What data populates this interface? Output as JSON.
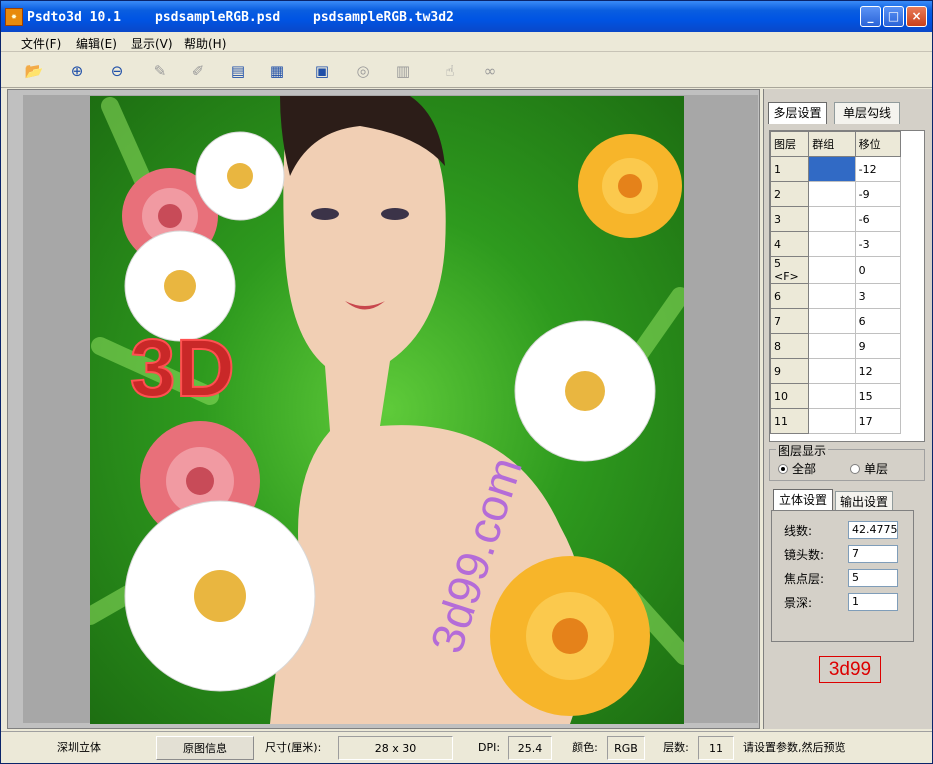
{
  "titlebar": {
    "app": "Psdto3d 10.1",
    "file_psd": "psdsampleRGB.psd",
    "file_tw3d2": "psdsampleRGB.tw3d2",
    "minimize": "_",
    "maximize": "□",
    "close": "×"
  },
  "menu": {
    "file": "文件(F)",
    "edit": "编辑(E)",
    "view": "显示(V)",
    "help": "帮助(H)"
  },
  "toolbar_icons": [
    "open-folder-icon",
    "zoom-in-icon",
    "zoom-out-icon",
    "pen-icon",
    "pen-line-icon",
    "layer-edit-icon",
    "layer-image-icon",
    "monitor-icon",
    "target-icon",
    "save-disk-icon",
    "hand-icon",
    "link-icon"
  ],
  "image": {
    "watermark_3d": "3D",
    "watermark_site": "3d99.com"
  },
  "panel": {
    "tab_multi": "多层设置",
    "tab_single": "单层勾线",
    "grid_headers": [
      "图层",
      "群组",
      "移位"
    ],
    "layers": [
      {
        "layer": "1",
        "group": "",
        "shift": "-12"
      },
      {
        "layer": "2",
        "group": "",
        "shift": "-9"
      },
      {
        "layer": "3",
        "group": "",
        "shift": "-6"
      },
      {
        "layer": "4",
        "group": "",
        "shift": "-3"
      },
      {
        "layer": "5 <F>",
        "group": "",
        "shift": "0"
      },
      {
        "layer": "6",
        "group": "",
        "shift": "3"
      },
      {
        "layer": "7",
        "group": "",
        "shift": "6"
      },
      {
        "layer": "8",
        "group": "",
        "shift": "9"
      },
      {
        "layer": "9",
        "group": "",
        "shift": "12"
      },
      {
        "layer": "10",
        "group": "",
        "shift": "15"
      },
      {
        "layer": "11",
        "group": "",
        "shift": "17"
      }
    ],
    "layer_display_title": "图层显示",
    "radio_all": "全部",
    "radio_single": "单层",
    "tab_stereo": "立体设置",
    "tab_output": "输出设置",
    "fields": {
      "lines_label": "线数:",
      "lines_value": "42.4775",
      "lens_label": "镜头数:",
      "lens_value": "7",
      "focus_label": "焦点层:",
      "focus_value": "5",
      "depth_label": "景深:",
      "depth_value": "1"
    },
    "brand": "3d99"
  },
  "status": {
    "company": "深圳立体",
    "original_info": "原图信息",
    "size_label": "尺寸(厘米):",
    "size_value": "28 x 30",
    "dpi_label": "DPI:",
    "dpi_value": "25.4",
    "color_label": "颜色:",
    "color_value": "RGB",
    "layers_label": "层数:",
    "layers_value": "11",
    "message": "请设置参数,然后预览"
  }
}
